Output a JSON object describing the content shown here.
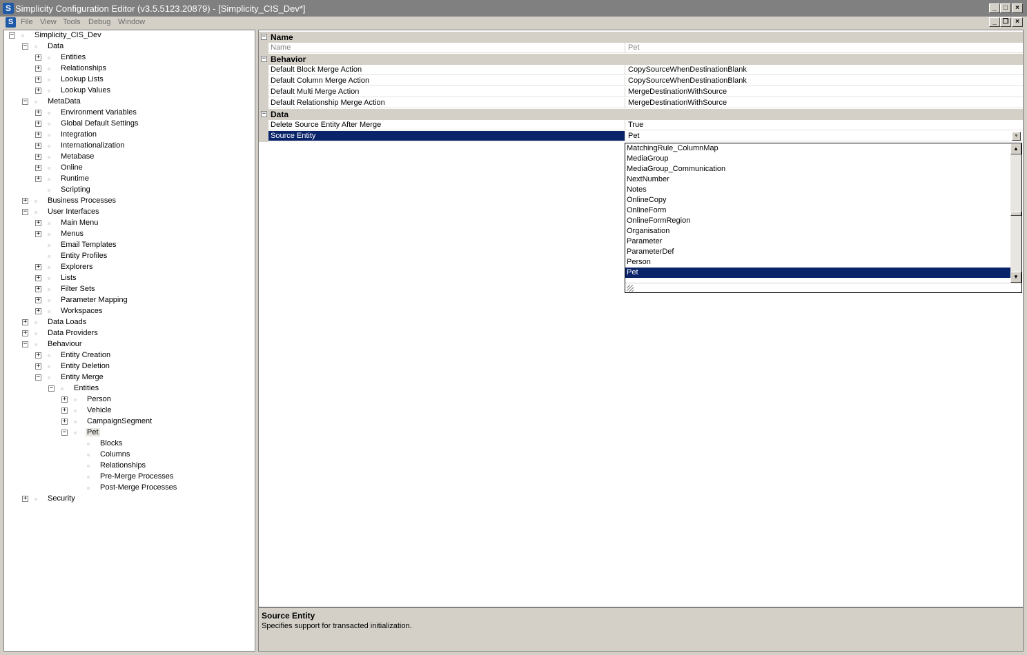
{
  "window": {
    "title": "Simplicity Configuration Editor (v3.5.5123.20879) - [Simplicity_CIS_Dev*]",
    "app_icon": "S",
    "controls": [
      "minimize-icon",
      "maximize-icon",
      "close-icon"
    ],
    "mdi_controls": [
      "minimize-icon",
      "restore-icon",
      "close-icon"
    ]
  },
  "menu": [
    "File",
    "View",
    "Tools",
    "Debug",
    "Window"
  ],
  "tree": [
    {
      "label": "Simplicity_CIS_Dev",
      "level": 0,
      "toggle": "minus"
    },
    {
      "label": "Data",
      "level": 1,
      "toggle": "minus"
    },
    {
      "label": "Entities",
      "level": 2,
      "toggle": "plus"
    },
    {
      "label": "Relationships",
      "level": 2,
      "toggle": "plus"
    },
    {
      "label": "Lookup Lists",
      "level": 2,
      "toggle": "plus"
    },
    {
      "label": "Lookup Values",
      "level": 2,
      "toggle": "plus"
    },
    {
      "label": "MetaData",
      "level": 1,
      "toggle": "minus"
    },
    {
      "label": "Environment Variables",
      "level": 2,
      "toggle": "plus"
    },
    {
      "label": "Global Default Settings",
      "level": 2,
      "toggle": "plus"
    },
    {
      "label": "Integration",
      "level": 2,
      "toggle": "plus"
    },
    {
      "label": "Internationalization",
      "level": 2,
      "toggle": "plus"
    },
    {
      "label": "Metabase",
      "level": 2,
      "toggle": "plus"
    },
    {
      "label": "Online",
      "level": 2,
      "toggle": "plus"
    },
    {
      "label": "Runtime",
      "level": 2,
      "toggle": "plus"
    },
    {
      "label": "Scripting",
      "level": 2,
      "toggle": ""
    },
    {
      "label": "Business Processes",
      "level": 1,
      "toggle": "plus"
    },
    {
      "label": "User Interfaces",
      "level": 1,
      "toggle": "minus"
    },
    {
      "label": "Main Menu",
      "level": 2,
      "toggle": "plus"
    },
    {
      "label": "Menus",
      "level": 2,
      "toggle": "plus"
    },
    {
      "label": "Email Templates",
      "level": 2,
      "toggle": ""
    },
    {
      "label": "Entity Profiles",
      "level": 2,
      "toggle": ""
    },
    {
      "label": "Explorers",
      "level": 2,
      "toggle": "plus"
    },
    {
      "label": "Lists",
      "level": 2,
      "toggle": "plus"
    },
    {
      "label": "Filter Sets",
      "level": 2,
      "toggle": "plus"
    },
    {
      "label": "Parameter Mapping",
      "level": 2,
      "toggle": "plus"
    },
    {
      "label": "Workspaces",
      "level": 2,
      "toggle": "plus"
    },
    {
      "label": "Data Loads",
      "level": 1,
      "toggle": "plus"
    },
    {
      "label": "Data Providers",
      "level": 1,
      "toggle": "plus"
    },
    {
      "label": "Behaviour",
      "level": 1,
      "toggle": "minus"
    },
    {
      "label": "Entity Creation",
      "level": 2,
      "toggle": "plus"
    },
    {
      "label": "Entity Deletion",
      "level": 2,
      "toggle": "plus"
    },
    {
      "label": "Entity Merge",
      "level": 2,
      "toggle": "minus"
    },
    {
      "label": "Entities",
      "level": 3,
      "toggle": "minus"
    },
    {
      "label": "Person",
      "level": 4,
      "toggle": "plus"
    },
    {
      "label": "Vehicle",
      "level": 4,
      "toggle": "plus"
    },
    {
      "label": "CampaignSegment",
      "level": 4,
      "toggle": "plus"
    },
    {
      "label": "Pet",
      "level": 4,
      "toggle": "minus",
      "selected": true
    },
    {
      "label": "Blocks",
      "level": 5,
      "toggle": ""
    },
    {
      "label": "Columns",
      "level": 5,
      "toggle": ""
    },
    {
      "label": "Relationships",
      "level": 5,
      "toggle": ""
    },
    {
      "label": "Pre-Merge Processes",
      "level": 5,
      "toggle": ""
    },
    {
      "label": "Post-Merge Processes",
      "level": 5,
      "toggle": ""
    },
    {
      "label": "Security",
      "level": 1,
      "toggle": "plus"
    }
  ],
  "propertygrid": [
    {
      "type": "category",
      "label": "Name"
    },
    {
      "type": "prop",
      "name": "Name",
      "value": "Pet",
      "readonly": true
    },
    {
      "type": "category",
      "label": "Behavior"
    },
    {
      "type": "prop",
      "name": "Default Block Merge Action",
      "value": "CopySourceWhenDestinationBlank"
    },
    {
      "type": "prop",
      "name": "Default Column Merge Action",
      "value": "CopySourceWhenDestinationBlank"
    },
    {
      "type": "prop",
      "name": "Default Multi Merge Action",
      "value": "MergeDestinationWithSource"
    },
    {
      "type": "prop",
      "name": "Default Relationship Merge Action",
      "value": "MergeDestinationWithSource"
    },
    {
      "type": "category",
      "label": "Data"
    },
    {
      "type": "prop",
      "name": "Delete Source Entity After Merge",
      "value": "True"
    },
    {
      "type": "prop",
      "name": "Source Entity",
      "value": "Pet",
      "selected": true,
      "dropdown": true
    }
  ],
  "dropdown": {
    "items": [
      "MatchingRule_ColumnMap",
      "MediaGroup",
      "MediaGroup_Communication",
      "NextNumber",
      "Notes",
      "OnlineCopy",
      "OnlineForm",
      "OnlineFormRegion",
      "Organisation",
      "Parameter",
      "ParameterDef",
      "Person",
      "Pet"
    ],
    "selected": "Pet"
  },
  "help": {
    "title": "Source Entity",
    "description": "Specifies support for transacted initialization."
  },
  "colors": {
    "selection": "#0a246a",
    "face": "#d4d0c8",
    "titlebar": "#808080"
  }
}
